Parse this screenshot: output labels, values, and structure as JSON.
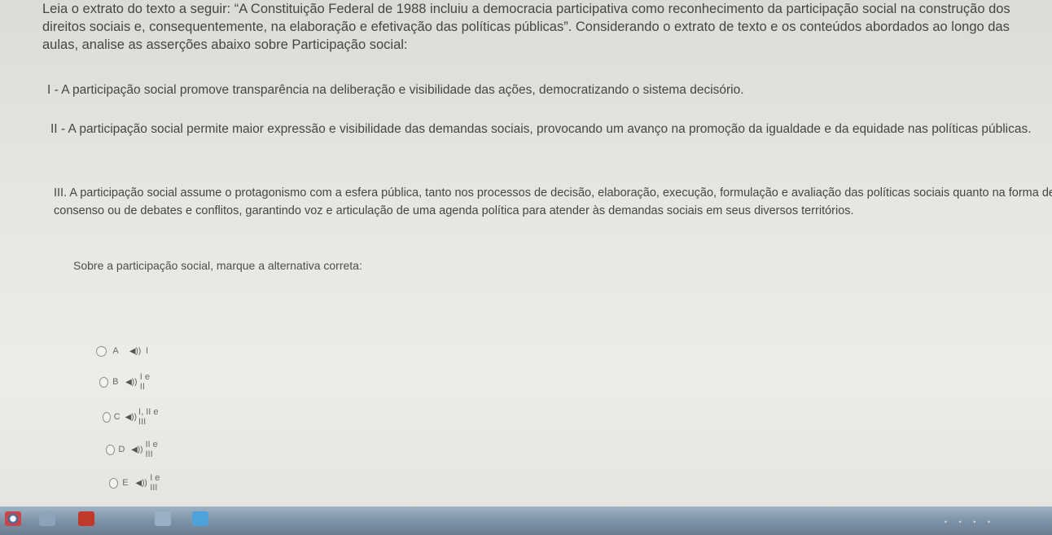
{
  "question": {
    "intro": "Leia o extrato do texto a seguir: “A Constituição Federal de 1988 incluiu a democracia participativa como reconhecimento da participação social na construção dos direitos sociais e, consequentemente, na elaboração e efetivação das políticas públicas”. Considerando o extrato de texto e os conteúdos abordados ao longo das aulas, analise as asserções abaixo sobre Participação social:",
    "items": [
      "I - A participação social promove transparência na deliberação e visibilidade das ações, democratizando o sistema decisório.",
      "II - A participação social permite maior expressão e visibilidade das demandas sociais, provocando um avanço na promoção da igualdade e da equidade nas políticas públicas.",
      "III. A participação social assume o protagonismo com a esfera pública, tanto nos processos de decisão, elaboração, execução, formulação e avaliação das políticas sociais quanto na forma de consenso ou de debates e conflitos, garantindo voz e articulação de uma agenda política para atender às demandas sociais em seus diversos territórios."
    ],
    "prompt": "Sobre a participação social, marque a alternativa correta:"
  },
  "options": [
    {
      "letter": "A",
      "value": "I"
    },
    {
      "letter": "B",
      "value": "I e II"
    },
    {
      "letter": "C",
      "value": "I, II e III"
    },
    {
      "letter": "D",
      "value": "II e III"
    },
    {
      "letter": "E",
      "value": "I e III"
    }
  ],
  "icons": {
    "audio": "speaker-icon",
    "taskbar": [
      "chrome-icon",
      "search-icon",
      "app-icon",
      "folder-icon",
      "window-icon"
    ]
  },
  "colors": {
    "background": "#e6e6e1",
    "text": "#454543",
    "taskbar": "#7f93a8"
  }
}
